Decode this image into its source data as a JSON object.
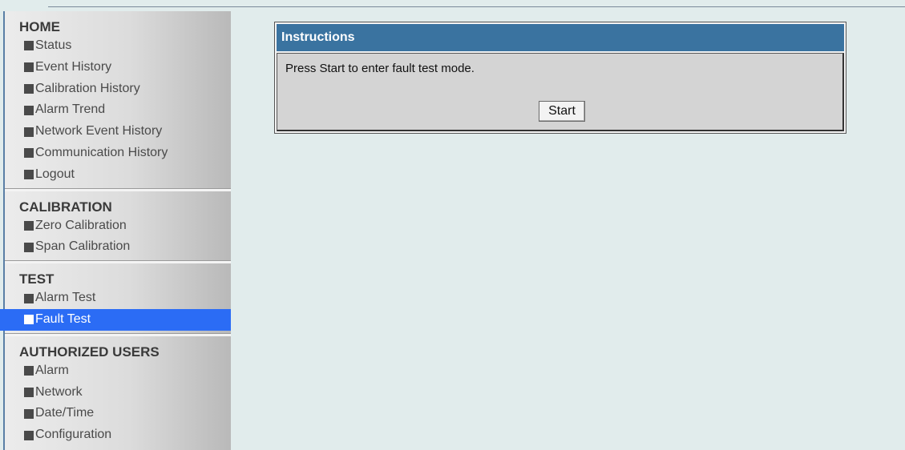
{
  "sidebar": {
    "sections": [
      {
        "title": "HOME",
        "items": [
          "Status",
          "Event History",
          "Calibration History",
          "Alarm Trend",
          "Network Event History",
          "Communication History",
          "Logout"
        ]
      },
      {
        "title": "CALIBRATION",
        "items": [
          "Zero Calibration",
          "Span Calibration"
        ]
      },
      {
        "title": "TEST",
        "items": [
          "Alarm Test",
          "Fault Test"
        ]
      },
      {
        "title": "AUTHORIZED USERS",
        "items": [
          "Alarm",
          "Network",
          "Date/Time",
          "Configuration"
        ]
      }
    ],
    "active_item": "Fault Test"
  },
  "panel": {
    "title": "Instructions",
    "message": "Press Start to enter fault test mode.",
    "start_label": "Start"
  },
  "colors": {
    "active_item_bg": "#2b6cf5",
    "panel_header_bg": "#3a73a0",
    "page_bg": "#e1ecec"
  }
}
